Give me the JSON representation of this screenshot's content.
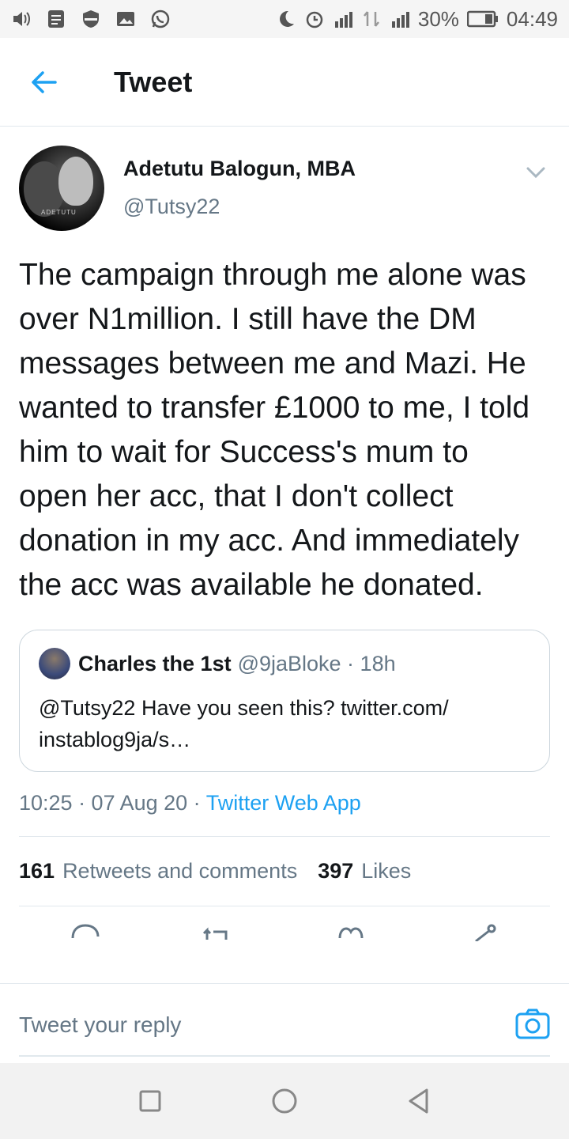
{
  "status_bar": {
    "battery": "30%",
    "time": "04:49"
  },
  "header": {
    "title": "Tweet"
  },
  "tweet": {
    "author_name": "Adetutu Balogun, MBA",
    "author_handle": "@Tutsy22",
    "text": "The campaign through me alone was over N1million. I still have the DM messages between me and Mazi. He wanted to transfer £1000 to me, I told him to wait for Success's mum to open her acc, that I don't collect donation in my acc. And immediately the acc was available he donated.",
    "timestamp": "10:25 · 07 Aug 20 · ",
    "source": "Twitter Web App"
  },
  "quote": {
    "name": "Charles the 1st",
    "meta": "@9jaBloke · 18h",
    "text": "@Tutsy22 Have you seen this? twitter.com/ instablog9ja/s…"
  },
  "stats": {
    "retweets_count": "161",
    "retweets_label": "Retweets and comments",
    "likes_count": "397",
    "likes_label": "Likes"
  },
  "reply": {
    "placeholder": "Tweet your reply"
  },
  "colors": {
    "accent": "#1da1f2",
    "secondary_text": "#657786",
    "divider": "#e1e8ed"
  },
  "icons": {
    "back": "arrow-left-icon",
    "caret": "chevron-down-icon",
    "camera": "camera-icon",
    "reply_action": "comment-icon",
    "retweet_action": "retweet-icon",
    "like_action": "heart-icon",
    "share_action": "share-icon"
  }
}
